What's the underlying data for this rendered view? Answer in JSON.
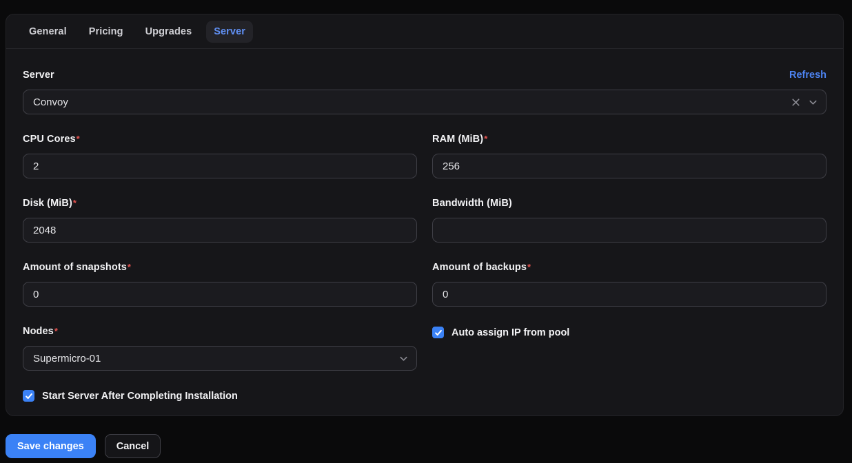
{
  "tabs": [
    {
      "label": "General",
      "active": false
    },
    {
      "label": "Pricing",
      "active": false
    },
    {
      "label": "Upgrades",
      "active": false
    },
    {
      "label": "Server",
      "active": true
    }
  ],
  "ui": {
    "required_marker": "*"
  },
  "server_picker": {
    "label": "Server",
    "refresh_label": "Refresh",
    "selected_value": "Convoy"
  },
  "fields": {
    "cpu_cores": {
      "label": "CPU Cores",
      "required": true,
      "value": "2"
    },
    "ram": {
      "label": "RAM (MiB)",
      "required": true,
      "value": "256"
    },
    "disk": {
      "label": "Disk (MiB)",
      "required": true,
      "value": "2048"
    },
    "bandwidth": {
      "label": "Bandwidth (MiB)",
      "required": false,
      "value": ""
    },
    "snapshots": {
      "label": "Amount of snapshots",
      "required": true,
      "value": "0"
    },
    "backups": {
      "label": "Amount of backups",
      "required": true,
      "value": "0"
    },
    "nodes": {
      "label": "Nodes",
      "required": true,
      "selected_value": "Supermicro-01"
    }
  },
  "checkboxes": {
    "auto_assign_ip": {
      "label": "Auto assign IP from pool",
      "checked": true
    },
    "start_server": {
      "label": "Start Server After Completing Installation",
      "checked": true
    }
  },
  "actions": {
    "save_label": "Save changes",
    "cancel_label": "Cancel"
  },
  "colors": {
    "accent_blue": "#3b82f6",
    "active_tab_text": "#6090f4",
    "refresh_link": "#4d84f3",
    "required_asterisk": "#e3524f",
    "panel_background": "#161619",
    "page_background": "#0a0a0b",
    "input_background": "#1b1b1f",
    "input_border": "#3f3f46"
  }
}
